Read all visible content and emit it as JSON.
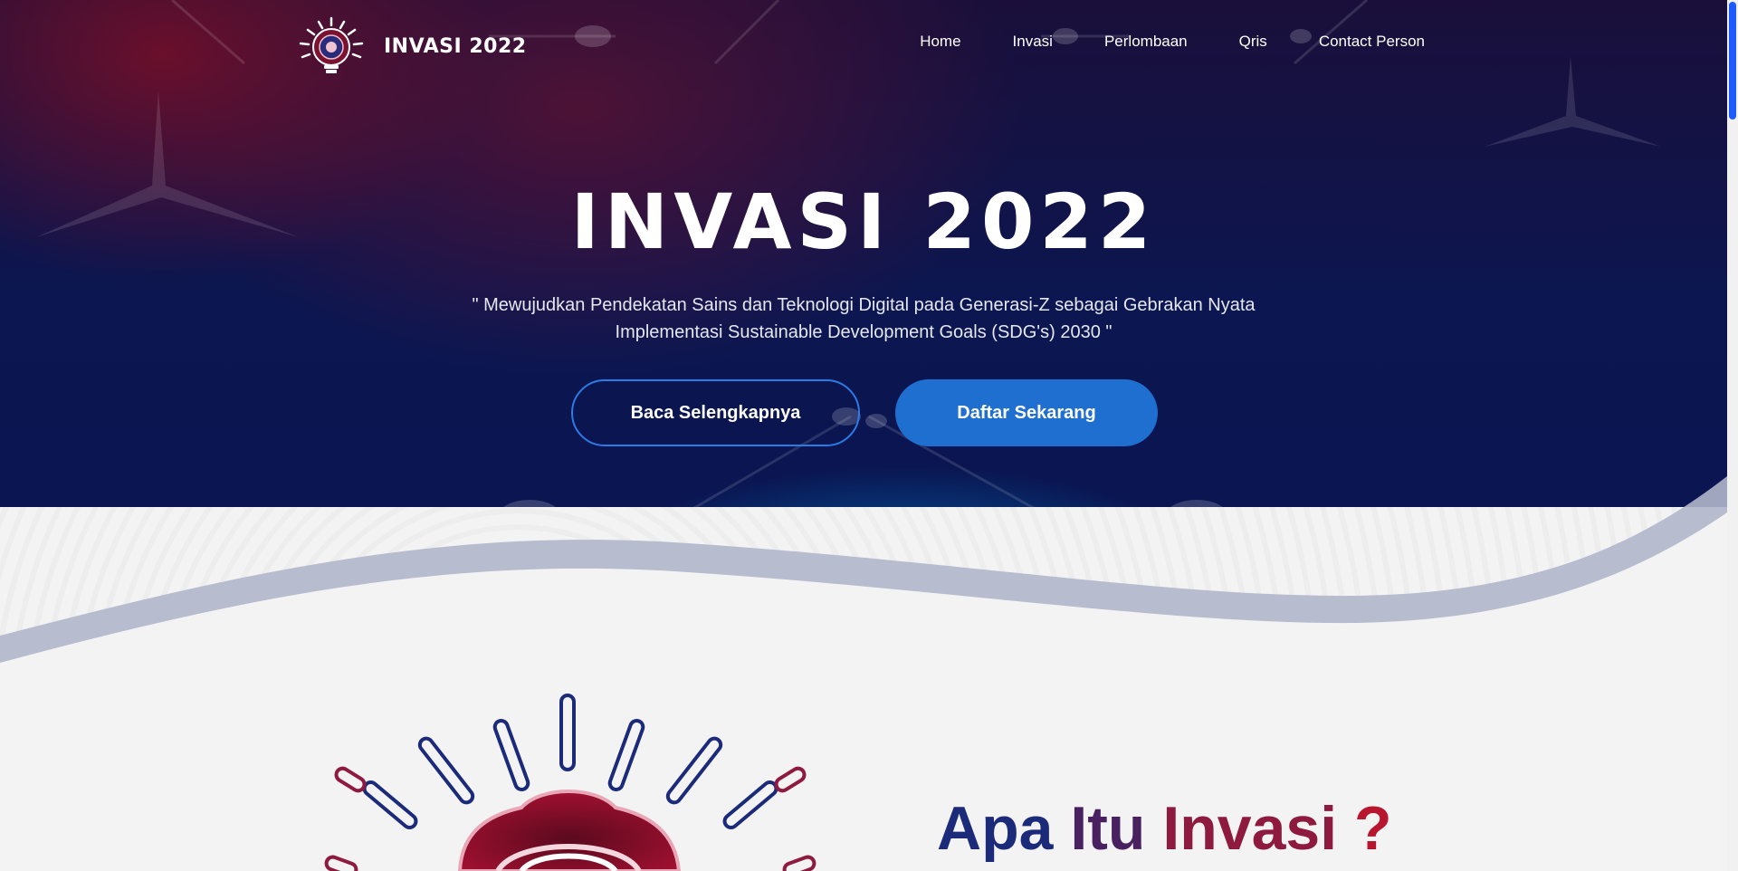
{
  "brand": {
    "name": "INVASI 2022"
  },
  "nav": {
    "items": [
      {
        "label": "Home"
      },
      {
        "label": "Invasi"
      },
      {
        "label": "Perlombaan"
      },
      {
        "label": "Qris"
      },
      {
        "label": "Contact Person"
      }
    ]
  },
  "hero": {
    "title": "INVASI 2022",
    "tagline_line1": "\" Mewujudkan Pendekatan Sains dan Teknologi Digital pada Generasi-Z sebagai Gebrakan Nyata",
    "tagline_line2": "Implementasi Sustainable Development Goals (SDG's) 2030 \"",
    "read_more_label": "Baca Selengkapnya",
    "register_label": "Daftar Sekarang"
  },
  "about": {
    "heading_word1": "Apa",
    "heading_word2": "Itu",
    "heading_word3": "Invasi",
    "heading_word4": "?"
  },
  "colors": {
    "accent_blue": "#1f6fd1",
    "heading_navy": "#1c2a7a",
    "heading_red": "#b8162e",
    "scroll_thumb": "#1e5bff"
  },
  "icons": {
    "logo": "lightbulb-logo-icon",
    "about_illustration": "lightbulb-badge-icon"
  }
}
